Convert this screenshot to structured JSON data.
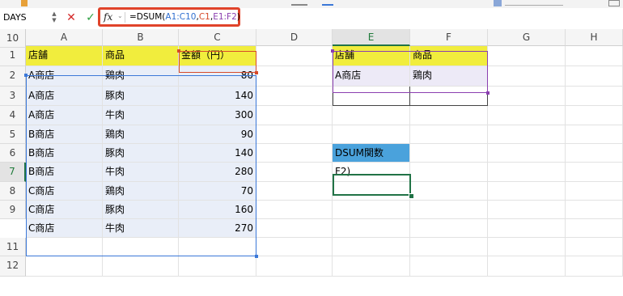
{
  "name_box": "DAYS",
  "formula_bar": {
    "fx_label": "fx",
    "formula_parts": [
      "=DSUM(",
      "A1:C10",
      ",",
      "C1",
      ",",
      "E1:F2",
      ")"
    ]
  },
  "columns": [
    "A",
    "B",
    "C",
    "D",
    "E",
    "F",
    "G",
    "H"
  ],
  "rows": [
    "1",
    "2",
    "3",
    "4",
    "5",
    "6",
    "7",
    "8",
    "9",
    "10",
    "11",
    "12"
  ],
  "cells": {
    "A1": "店舗",
    "B1": "商品",
    "C1": "金額（円）",
    "A2": "A商店",
    "B2": "鶏肉",
    "C2": "80",
    "A3": "A商店",
    "B3": "豚肉",
    "C3": "140",
    "A4": "A商店",
    "B4": "牛肉",
    "C4": "300",
    "A5": "B商店",
    "B5": "鶏肉",
    "C5": "90",
    "A6": "B商店",
    "B6": "豚肉",
    "C6": "140",
    "A7": "B商店",
    "B7": "牛肉",
    "C7": "280",
    "A8": "C商店",
    "B8": "鶏肉",
    "C8": "70",
    "A9": "C商店",
    "B9": "豚肉",
    "C9": "160",
    "A10": "C商店",
    "B10": "牛肉",
    "C10": "270",
    "E1": "店舗",
    "F1": "商品",
    "E2": "A商店",
    "F2": "鶏肉",
    "E6": "DSUM関数",
    "E7": "F2)"
  },
  "active_cell": "E7",
  "colors": {
    "header_yellow": "#f1ed3d",
    "criteria_lavender": "#edeaf7",
    "dsum_label_blue": "#4aa2dc",
    "ref_blue": "#3b78d8",
    "ref_red": "#d64a2a",
    "ref_purple": "#8b3fb0",
    "active_green": "#217346"
  }
}
